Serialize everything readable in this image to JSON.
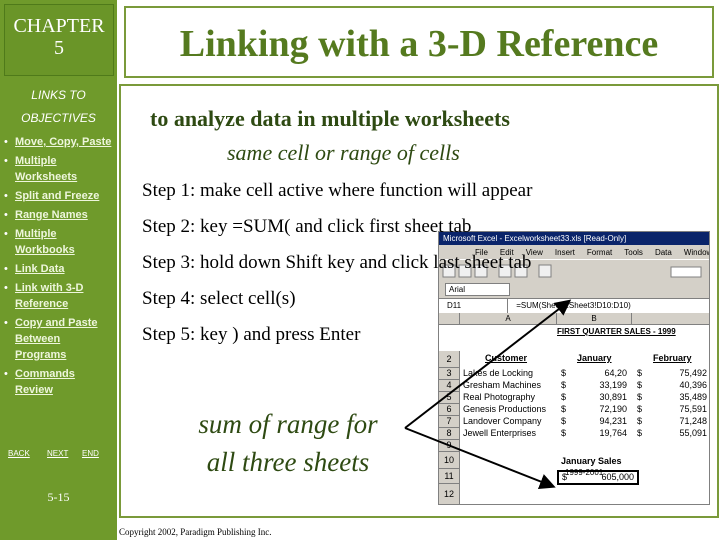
{
  "sidebar": {
    "chapter_line1": "CHAPTER",
    "chapter_line2": "5",
    "links_to": "LINKS TO",
    "objectives_title": "OBJECTIVES",
    "objectives": [
      {
        "label": "Move, Copy, Paste"
      },
      {
        "label": "Multiple Worksheets"
      },
      {
        "label": "Split and Freeze"
      },
      {
        "label": "Range Names"
      },
      {
        "label": "Multiple Workbooks"
      },
      {
        "label": "Link Data"
      },
      {
        "label": "Link with 3-D Reference"
      },
      {
        "label": "Copy and Paste Between Programs"
      },
      {
        "label": "Commands Review"
      }
    ],
    "nav": {
      "back": "BACK",
      "next": "NEXT",
      "end": "END"
    },
    "page_number": "5-15",
    "bg_color": "#6f9a2b"
  },
  "title": "Linking with a 3-D Reference",
  "subtitle1": "to analyze data in multiple worksheets",
  "subtitle2": "same cell or range of cells",
  "steps": [
    "Step 1: make cell active where function will appear",
    "Step 2: key =SUM( and click first sheet tab",
    "Step 3: hold down Shift key and click last sheet tab",
    "Step 4: select cell(s)",
    "Step 5: key ) and press Enter"
  ],
  "callout": {
    "line1": "sum of range for",
    "line2": "all three sheets"
  },
  "copyright": "Copyright 2002, Paradigm Publishing Inc.",
  "excel": {
    "title_bar": "Microsoft Excel - Excelworksheet33.xls [Read-Only]",
    "menu": [
      "File",
      "Edit",
      "View",
      "Insert",
      "Format",
      "Tools",
      "Data",
      "Window"
    ],
    "font_box": "Arial",
    "name_box": "D11",
    "formula": "=SUM(Sheet1:Sheet3!D10:D10)",
    "col_a": "A",
    "col_b": "B",
    "sheet_title": "FIRST QUARTER SALES - 1999",
    "headers": {
      "customer": "Customer",
      "january": "January",
      "february": "February"
    },
    "rows": [
      {
        "num": "3",
        "name": "Lakes de Locking",
        "jan": "64,20",
        "feb": "75,492"
      },
      {
        "num": "4",
        "name": "Gresham Machines",
        "jan": "33,199",
        "feb": "40,396"
      },
      {
        "num": "5",
        "name": "Real Photography",
        "jan": "30,891",
        "feb": "35,489"
      },
      {
        "num": "6",
        "name": "Genesis Productions",
        "jan": "72,190",
        "feb": "75,591"
      },
      {
        "num": "7",
        "name": "Landover Company",
        "jan": "94,231",
        "feb": "71,248"
      },
      {
        "num": "8",
        "name": "Jewell Enterprises",
        "jan": "19,764",
        "feb": "55,091"
      }
    ],
    "row_numbers": [
      "2",
      "9",
      "10",
      "11",
      "12"
    ],
    "dollar": "$",
    "summary_label": "January Sales",
    "summary_years": "1999-2001",
    "summary_value": "605,000"
  }
}
